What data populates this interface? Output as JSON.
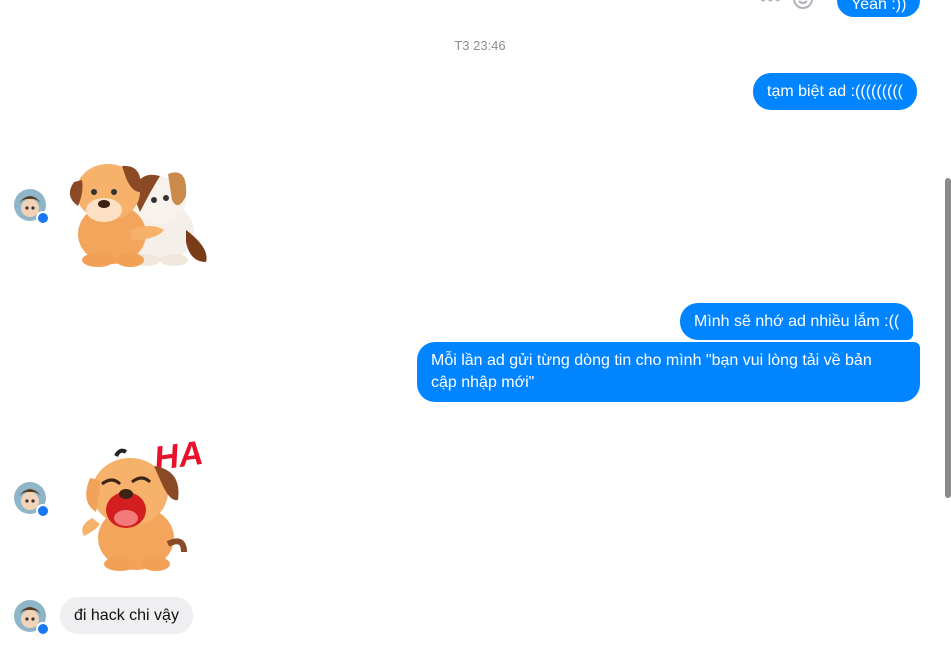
{
  "messages": {
    "top_partial": "Yeah :))",
    "timestamp": "T3 23:46",
    "out_1": "tạm biệt ad :(((((((((",
    "out_2": "Mình sẽ nhớ ad nhiều lắm :((",
    "out_3": "Mỗi lần ad gửi từng dòng tin cho mình \"bạn vui lòng tải về bản cập nhập mới\"",
    "out_3_line1": "Mỗi lần ad gửi từng dòng tin cho mình \"bạn vui lòng tải về bản",
    "out_3_line2": "cập nhập mới\"",
    "in_1": "đi hack chi vậy",
    "sticker_text": "HA"
  },
  "colors": {
    "outgoing": "#0084ff",
    "incoming": "#efeff1",
    "timestamp": "#8a8d91",
    "badge": "#1877f2"
  }
}
